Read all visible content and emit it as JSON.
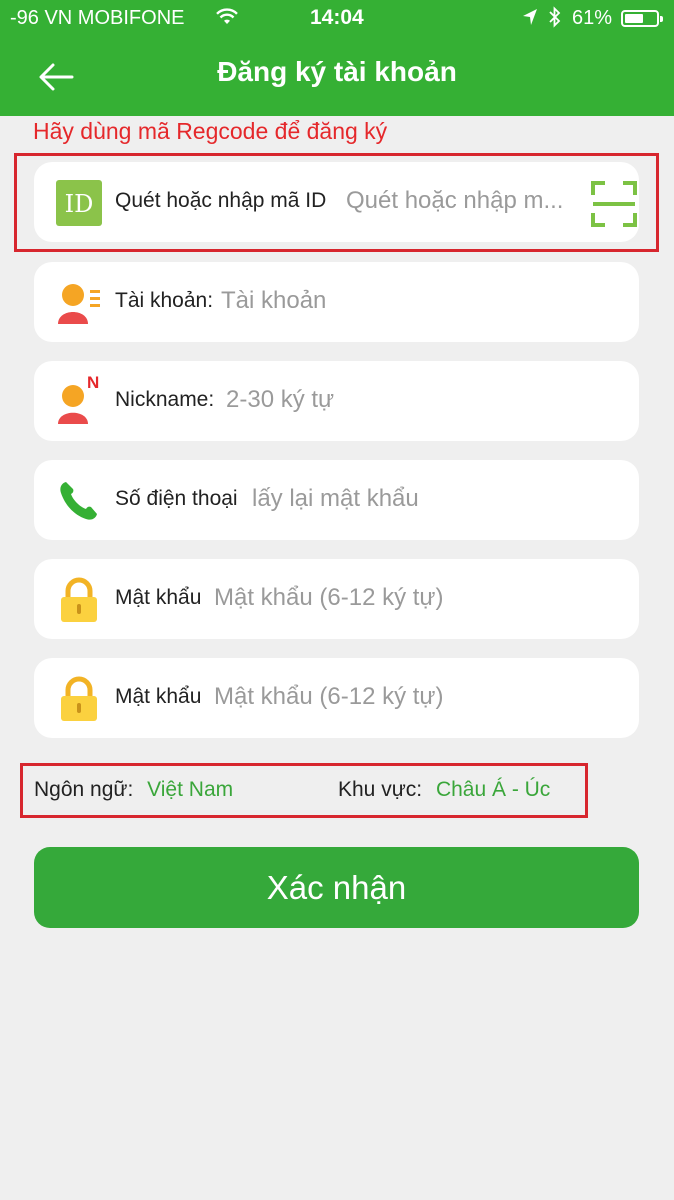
{
  "status_bar": {
    "carrier": "-96 VN MOBIFONE",
    "time": "14:04",
    "battery": "61%",
    "battery_level": 0.61
  },
  "header": {
    "title": "Đăng ký tài khoản",
    "back_icon": "arrow-left-icon"
  },
  "hint": "Hãy dùng mã Regcode để đăng ký",
  "colors": {
    "brand_green": "#35b034",
    "hint_red": "#e5282b",
    "value_green": "#3aa63a",
    "highlight_red": "#d7262e"
  },
  "form": {
    "id_field": {
      "label": "Quét hoặc nhập mã ID",
      "placeholder": "Quét hoặc nhập m...",
      "icon": "id-badge-icon",
      "scan_icon": "qr-scan-icon"
    },
    "account": {
      "label": "Tài khoản:",
      "placeholder": "Tài khoản",
      "icon": "user-list-icon"
    },
    "nickname": {
      "label": "Nickname:",
      "placeholder": "2-30 ký tự",
      "icon": "user-n-icon",
      "badge": "N"
    },
    "phone": {
      "label": "Số điện thoại",
      "placeholder": "lấy lại mật khẩu",
      "icon": "phone-icon"
    },
    "password": {
      "label": "Mật khẩu",
      "placeholder": "Mật khẩu (6-12 ký tự)",
      "icon": "lock-icon"
    },
    "password_confirm": {
      "label": "Mật khẩu",
      "placeholder": "Mật khẩu (6-12 ký tự)",
      "icon": "lock-icon"
    }
  },
  "settings": {
    "language_label": "Ngôn ngữ:",
    "language_value": "Việt Nam",
    "region_label": "Khu vực:",
    "region_value": "Châu Á - Úc"
  },
  "confirm_button": "Xác nhận"
}
